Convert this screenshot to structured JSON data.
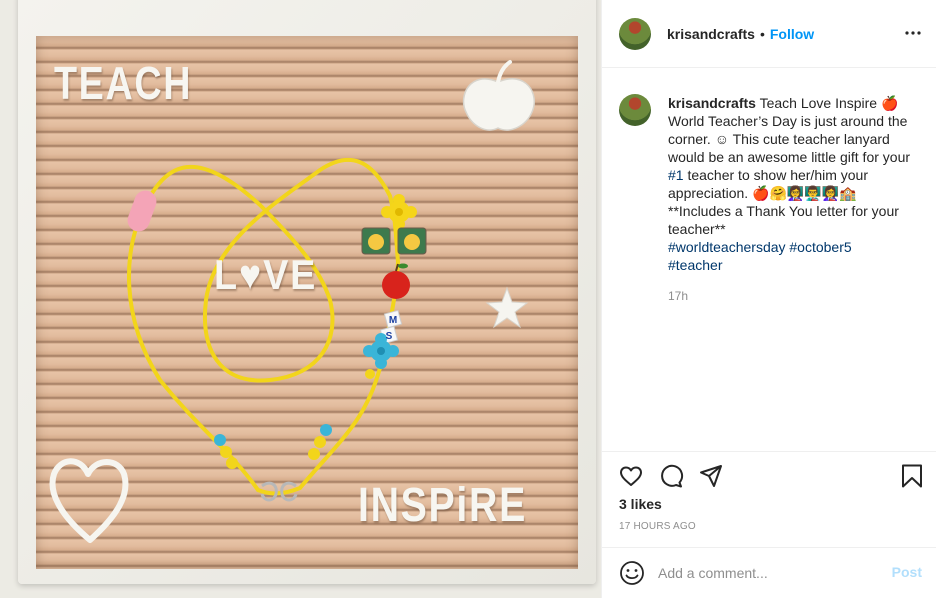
{
  "photo": {
    "felt_words": {
      "teach": "TEACH",
      "love": "L♥VE",
      "inspire": "INSPiRE"
    },
    "bead_letters": [
      "M",
      "S"
    ]
  },
  "header": {
    "username": "krisandcrafts",
    "separator": "•",
    "follow_label": "Follow",
    "more_icon": "more-options-icon"
  },
  "caption": {
    "username": "krisandcrafts",
    "text_1": "Teach Love Inspire 🍎 World Teacher’s Day is just around the corner. ☺ This cute teacher lanyard would be an awesome little gift for your ",
    "tag_1": "#1",
    "text_2": " teacher to show her/him your appreciation. 🍎🤗👩‍🏫👨‍🏫👩‍🏫🏫",
    "text_3": "**Includes a Thank You letter for your teacher**",
    "hashtags_1": "#worldteachersday #october5",
    "hashtags_2": "#teacher",
    "time": "17h"
  },
  "actions": {
    "icons": [
      "heart-icon",
      "comment-bubble-icon",
      "share-plane-icon",
      "bookmark-icon"
    ],
    "likes": "3 likes",
    "date": "17 HOURS AGO"
  },
  "comment_box": {
    "emoji_icon": "smiley-icon",
    "placeholder": "Add a comment...",
    "post_label": "Post"
  },
  "colors": {
    "accent": "#0095f6",
    "post_disabled": "#b2dffc",
    "hashtag": "#00376b",
    "muted": "#8e8e8e",
    "lanyard": "#f2d51b",
    "felt": "#dcb496"
  }
}
